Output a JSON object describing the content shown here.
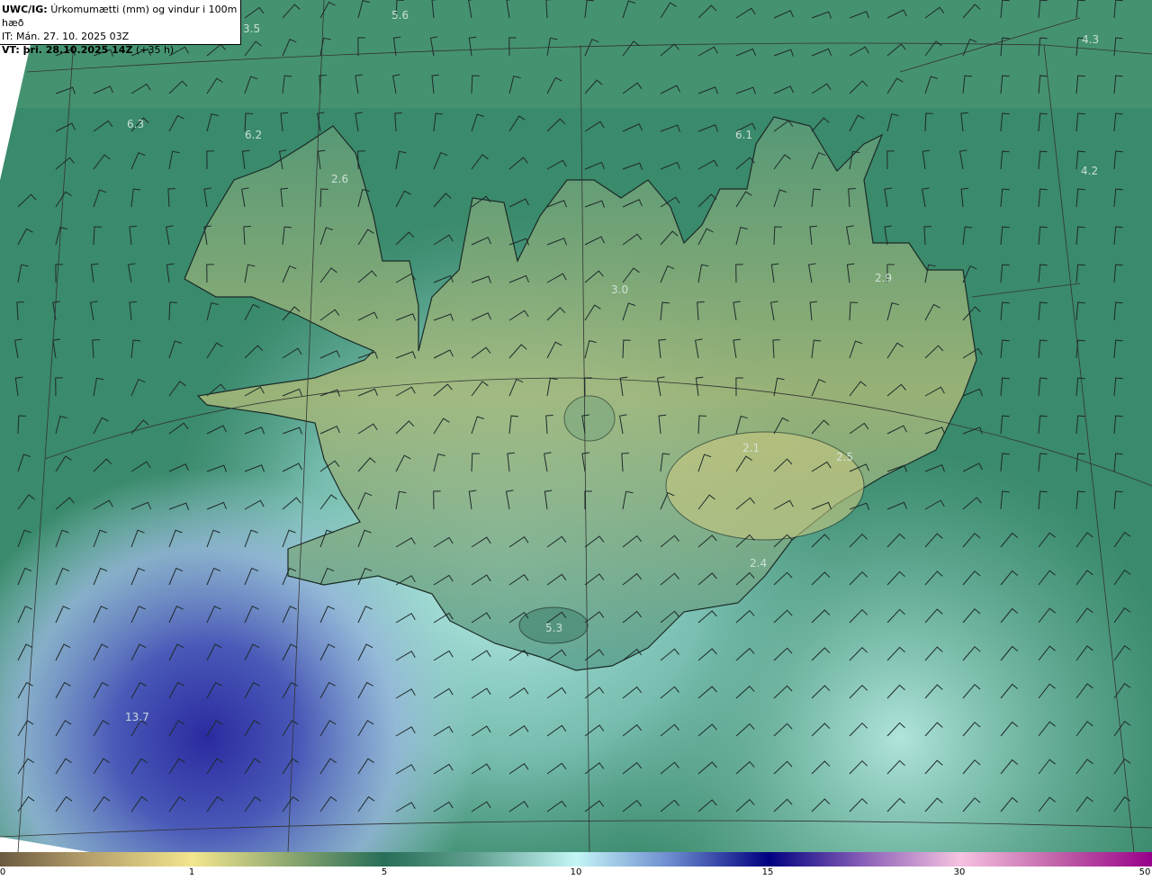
{
  "header": {
    "model": "UWC/IG:",
    "title": "Úrkomumætti (mm) og vindur i 100m hæð",
    "it": "IT: Mán. 27. 10. 2025 03Z",
    "vt_bold": "VT: þri. 28.10.2025 14Z",
    "vt_lead": "(+35 h)"
  },
  "map": {
    "labels": [
      "5.6",
      "3.5",
      "4.3",
      "6.3",
      "6.2",
      "6.1",
      "4.2",
      "2.6",
      "3.0",
      "2.9",
      "2.1",
      "2.5",
      "2.4",
      "5.3",
      "13.7"
    ]
  },
  "colorbar": {
    "ticks": [
      "0",
      "1",
      "5",
      "10",
      "15",
      "30",
      "50"
    ],
    "colors": [
      "#6b5a40",
      "#f3e68e",
      "#276e58",
      "#c4f6f6",
      "#000080",
      "#f6c2e0",
      "#98008a"
    ]
  }
}
